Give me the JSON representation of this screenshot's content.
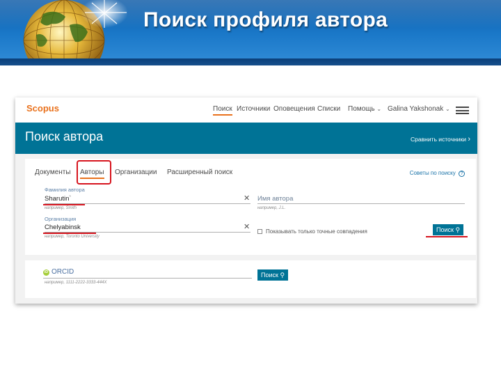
{
  "slide": {
    "title": "Поиск профиля автора",
    "colors": {
      "header_blue": "#1a78c8",
      "title_text": "#ffffff"
    }
  },
  "scopus": {
    "logo": "Scopus",
    "nav": {
      "search": "Поиск",
      "sources": "Источники",
      "alerts": "Оповещения",
      "lists": "Списки",
      "help": "Помощь",
      "user": "Galina Yakshonak"
    },
    "banner": {
      "title": "Поиск автора",
      "compare_link": "Сравнить источники"
    },
    "tabs": {
      "documents": "Документы",
      "authors": "Авторы",
      "organizations": "Организации",
      "advanced": "Расширенный поиск"
    },
    "tips_link": "Советы по поиску",
    "form": {
      "lastname_label": "Фамилия автора",
      "lastname_value": "Sharutin",
      "lastname_marker": "*",
      "lastname_hint": "например, Smith",
      "firstname_placeholder": "Имя автора",
      "firstname_hint": "например, J.L.",
      "org_label": "Организация",
      "org_value": "Chelyabinsk",
      "org_hint": "например, Toronto University",
      "exact_match_label": "Показывать только точные совпадения",
      "search_button": "Поиск"
    },
    "orcid": {
      "badge": "iD",
      "label": "ORCID",
      "hint": "например, 1111-2222-3333-444X",
      "search_button": "Поиск"
    },
    "colors": {
      "teal": "#007396",
      "orange_accent": "#e9711c",
      "annotation_red": "#d7141e"
    },
    "icons": [
      "chevron-down-icon",
      "menu-icon",
      "chevron-right-icon",
      "info-icon",
      "clear-icon",
      "magnifier-icon",
      "orcid-icon"
    ]
  }
}
